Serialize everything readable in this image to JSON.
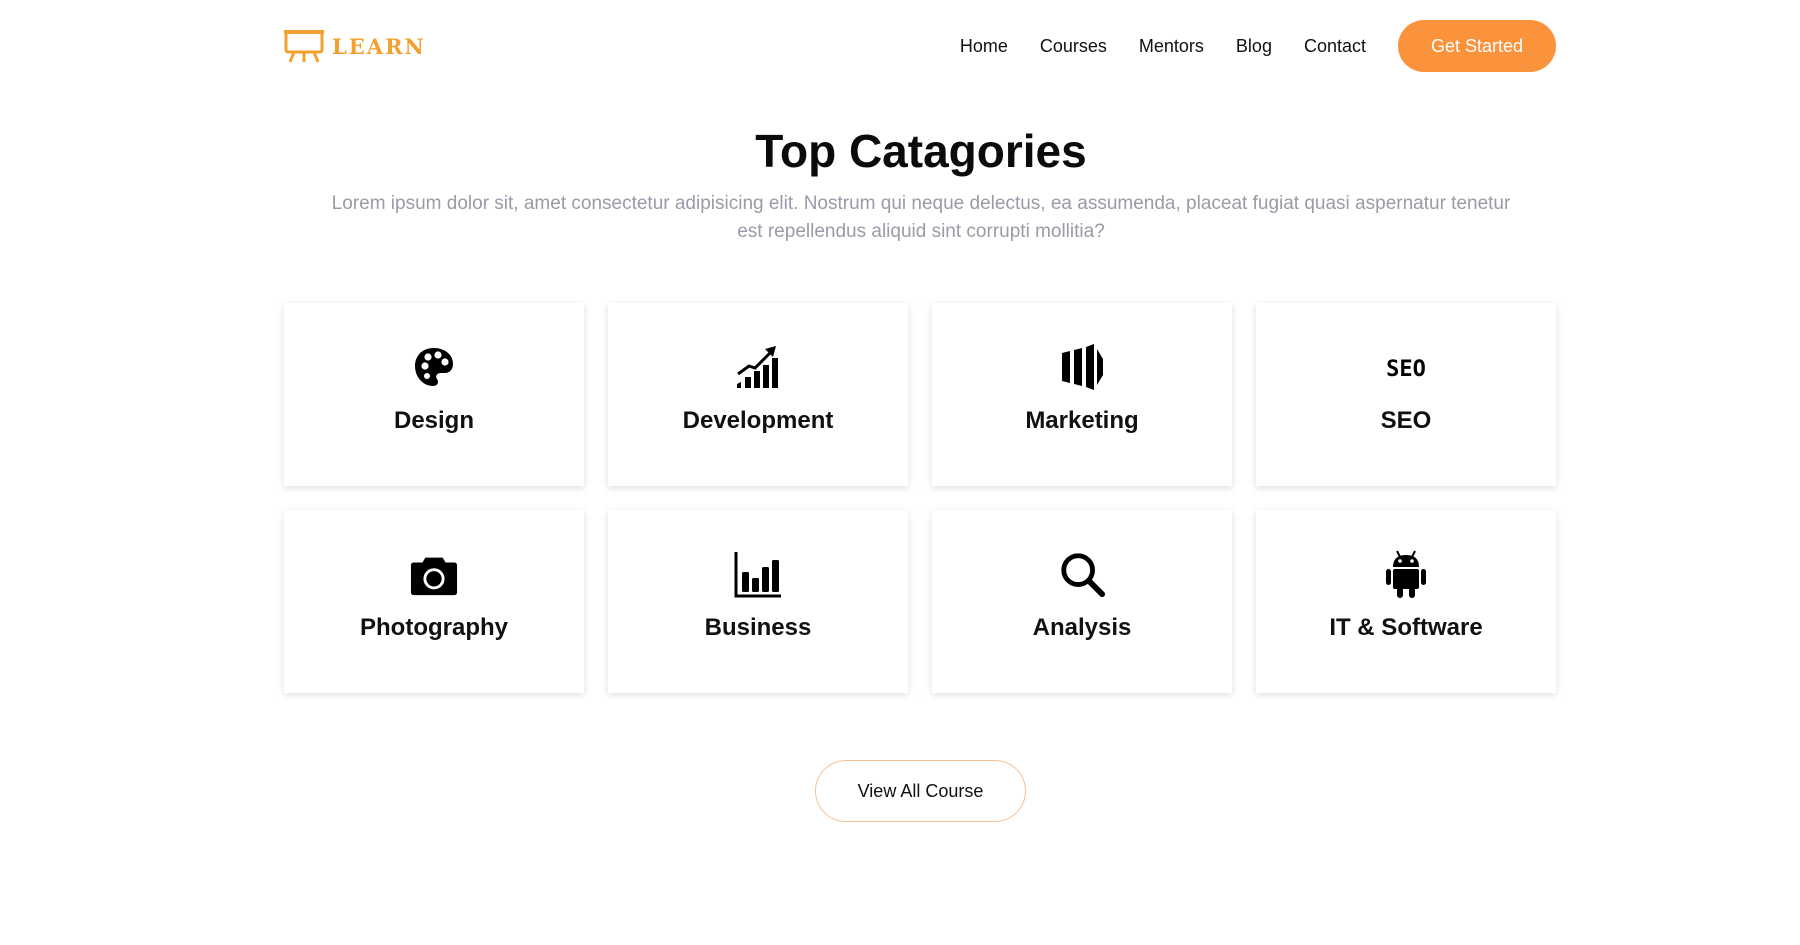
{
  "brand": {
    "name": "LEARN",
    "color": "#f2a12e",
    "icon": "easel-board-icon"
  },
  "nav": {
    "links": [
      "Home",
      "Courses",
      "Mentors",
      "Blog",
      "Contact"
    ],
    "cta": "Get Started",
    "cta_color": "#fb923c"
  },
  "section": {
    "title": "Top Catagories",
    "subtitle": "Lorem ipsum dolor sit, amet consectetur adipisicing elit. Nostrum qui neque delectus, ea assumenda, placeat fugiat quasi aspernatur tenetur est repellendus aliquid sint corrupti mollitia?"
  },
  "categories": [
    {
      "label": "Design",
      "icon": "palette-icon"
    },
    {
      "label": "Development",
      "icon": "growth-chart-icon"
    },
    {
      "label": "Marketing",
      "icon": "marketing-bars-icon"
    },
    {
      "label": "SEO",
      "icon": "seo-icon"
    },
    {
      "label": "Photography",
      "icon": "camera-icon"
    },
    {
      "label": "Business",
      "icon": "bar-chart-icon"
    },
    {
      "label": "Analysis",
      "icon": "search-icon"
    },
    {
      "label": "IT & Software",
      "icon": "android-icon"
    }
  ],
  "view_all": {
    "label": "View All Course",
    "border_color": "#f6c193"
  }
}
